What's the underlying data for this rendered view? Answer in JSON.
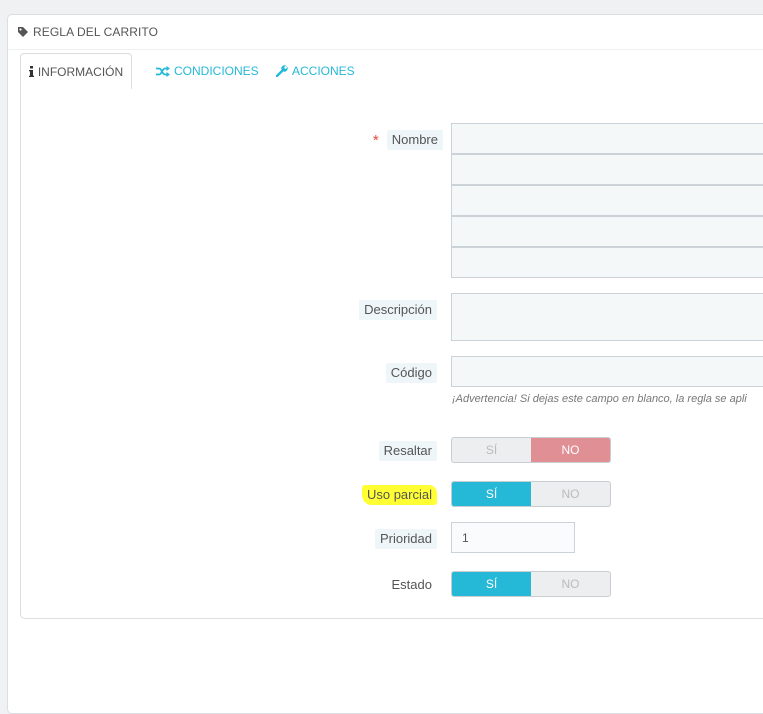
{
  "panel": {
    "title": "REGLA DEL CARRITO",
    "icon": "tag-icon"
  },
  "tabs": [
    {
      "label": "INFORMACIÓN",
      "icon": "info-icon",
      "active": true
    },
    {
      "label": "CONDICIONES",
      "icon": "shuffle-icon",
      "active": false
    },
    {
      "label": "ACCIONES",
      "icon": "wrench-icon",
      "active": false
    }
  ],
  "form": {
    "name": {
      "label": "Nombre",
      "required_mark": "*",
      "values": [
        "",
        "",
        "",
        "",
        ""
      ]
    },
    "description": {
      "label": "Descripción",
      "value": ""
    },
    "code": {
      "label": "Código",
      "value": "",
      "help": "¡Advertencia! Si dejas este campo en blanco, la regla se apli"
    },
    "highlight": {
      "label": "Resaltar",
      "yes": "SÍ",
      "no": "NO",
      "selected": "NO"
    },
    "partial_use": {
      "label": "Uso parcial",
      "yes": "SÍ",
      "no": "NO",
      "selected": "SÍ"
    },
    "priority": {
      "label": "Prioridad",
      "value": "1"
    },
    "status": {
      "label": "Estado",
      "yes": "SÍ",
      "no": "NO",
      "selected": "SÍ"
    }
  },
  "colors": {
    "accent": "#25b9d7",
    "no_active": "#e08f95",
    "highlight_marker": "#ffff33",
    "required": "#e34a3a"
  }
}
